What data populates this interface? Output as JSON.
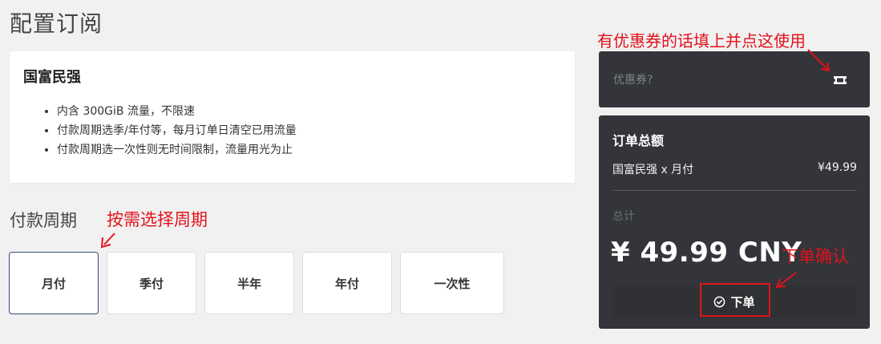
{
  "page_title": "配置订阅",
  "plan": {
    "name": "国富民强",
    "features": [
      "内含 300GiB 流量，不限速",
      "付款周期选季/年付等，每月订单日清空已用流量",
      "付款周期选一次性则无时间限制，流量用光为止"
    ]
  },
  "period": {
    "label": "付款周期",
    "options": [
      "月付",
      "季付",
      "半年",
      "年付",
      "一次性"
    ],
    "selected": "月付"
  },
  "coupon": {
    "placeholder": "优惠券?",
    "icon": "ticket-icon"
  },
  "summary": {
    "title": "订单总额",
    "line_item": "国富民强 x 月付",
    "line_price": "¥49.99",
    "total_label": "总计",
    "total_amount": "¥ 49.99 CNY",
    "order_button": "下单",
    "order_icon": "check-circle-icon"
  },
  "annotations": {
    "coupon_hint": "有优惠券的话填上并点这使用",
    "period_hint": "按需选择周期",
    "order_hint": "下单确认",
    "color": "#e3111b"
  },
  "colors": {
    "panel_dark": "#33353a",
    "selected_border": "#3a4a73",
    "page_bg": "#f1f1f1"
  }
}
